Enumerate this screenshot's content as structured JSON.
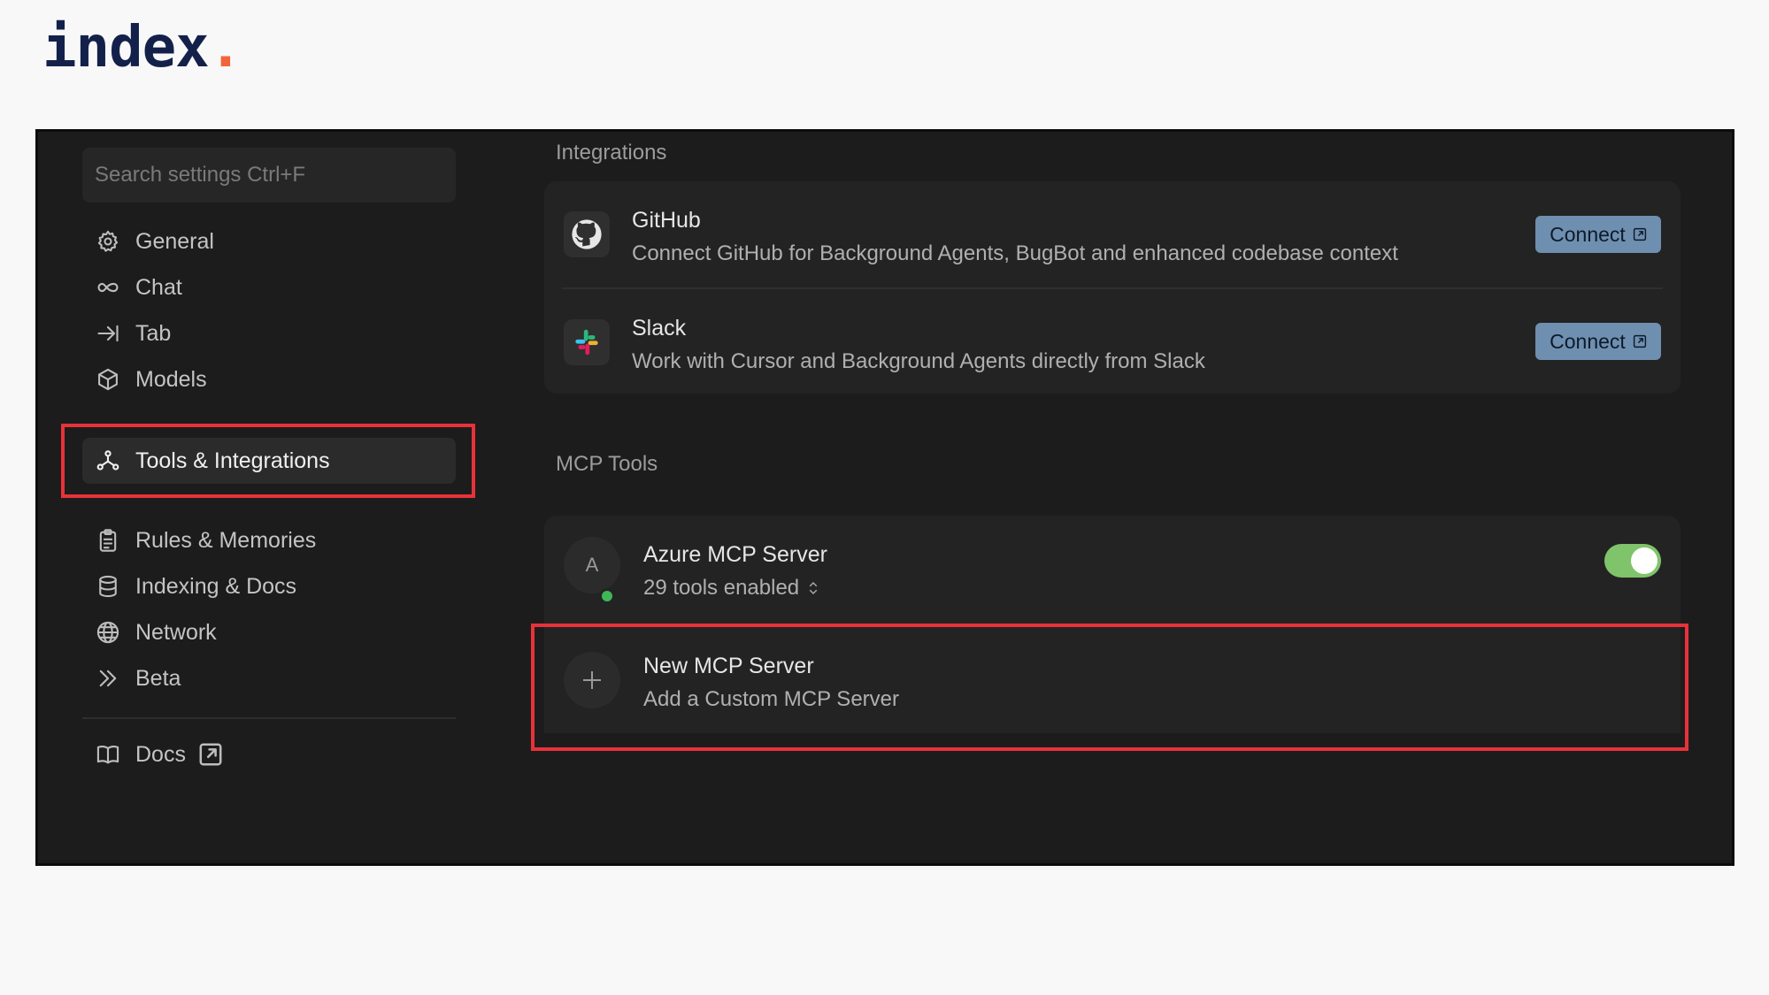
{
  "logo": {
    "text": "index",
    "dot": "."
  },
  "sidebar": {
    "search_placeholder": "Search settings Ctrl+F",
    "items": [
      {
        "label": "General",
        "icon": "gear-icon"
      },
      {
        "label": "Chat",
        "icon": "infinity-icon"
      },
      {
        "label": "Tab",
        "icon": "tab-arrow-icon"
      },
      {
        "label": "Models",
        "icon": "cube-icon"
      },
      {
        "label": "Tools & Integrations",
        "icon": "nodes-icon",
        "active": true
      },
      {
        "label": "Rules & Memories",
        "icon": "clipboard-icon"
      },
      {
        "label": "Indexing & Docs",
        "icon": "database-icon"
      },
      {
        "label": "Network",
        "icon": "globe-icon"
      },
      {
        "label": "Beta",
        "icon": "chevrons-right-icon"
      }
    ],
    "docs_label": "Docs"
  },
  "integrations": {
    "title": "Integrations",
    "items": [
      {
        "name": "GitHub",
        "description": "Connect GitHub for Background Agents, BugBot and enhanced codebase context",
        "button": "Connect",
        "icon": "github-icon"
      },
      {
        "name": "Slack",
        "description": "Work with Cursor and Background Agents directly from Slack",
        "button": "Connect",
        "icon": "slack-icon"
      }
    ]
  },
  "mcp": {
    "title": "MCP Tools",
    "servers": [
      {
        "initial": "A",
        "name": "Azure MCP Server",
        "status": "29 tools enabled",
        "enabled": true
      }
    ],
    "new_server": {
      "title": "New MCP Server",
      "subtitle": "Add a Custom MCP Server"
    }
  },
  "colors": {
    "highlight": "#e8323a",
    "toggle_on": "#7fc46a",
    "connect_button": "#6f8fb0",
    "status_green": "#3fb757",
    "logo_accent": "#f2653a"
  }
}
